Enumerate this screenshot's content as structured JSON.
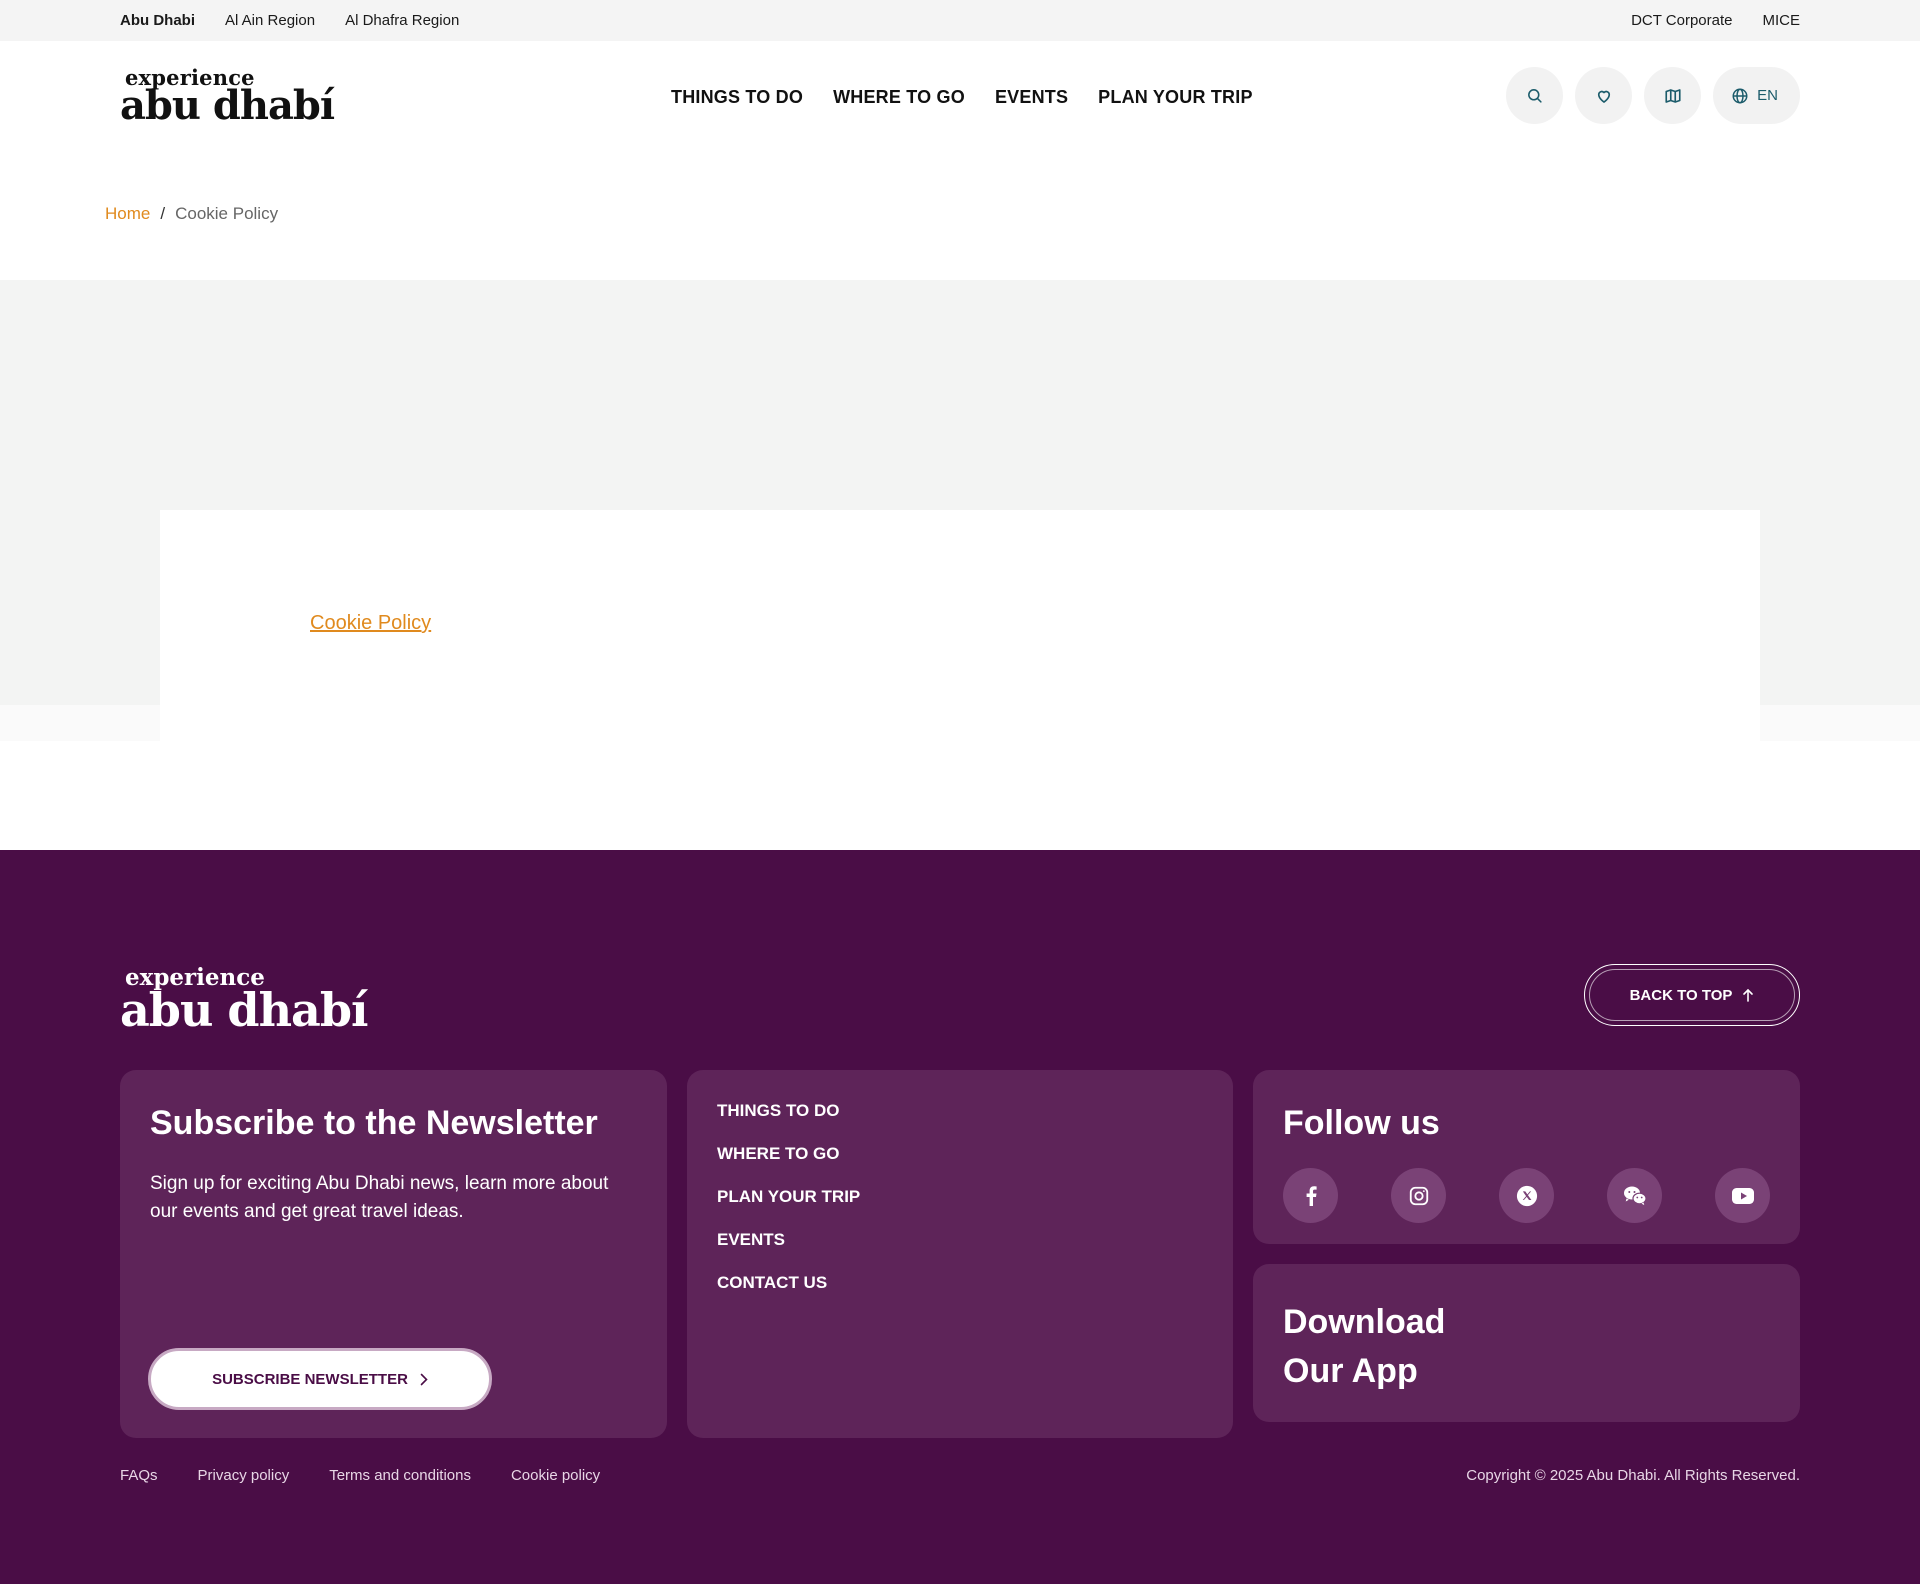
{
  "topbar": {
    "left_links": [
      "Abu Dhabi",
      "Al Ain Region",
      "Al Dhafra Region"
    ],
    "right_links": [
      "DCT Corporate",
      "MICE"
    ]
  },
  "header": {
    "logo_small": "experience",
    "logo_big": "abu dhabí",
    "nav": [
      "THINGS TO DO",
      "WHERE TO GO",
      "EVENTS",
      "PLAN YOUR TRIP"
    ],
    "actions": {
      "search_icon": "search-icon",
      "favorites_icon": "heart-icon",
      "map_icon": "map-icon",
      "language_icon": "globe-icon",
      "language": "EN"
    }
  },
  "breadcrumb": {
    "home": "Home",
    "separator": "/",
    "current": "Cookie Policy"
  },
  "content": {
    "link": "Cookie Policy"
  },
  "footer": {
    "logo_small": "experience",
    "logo_big": "abu dhabí",
    "back_to_top": "BACK TO TOP",
    "newsletter": {
      "title": "Subscribe to the Newsletter",
      "description": "Sign up for exciting Abu Dhabi news, learn more about our events and get great travel ideas.",
      "button": "SUBSCRIBE NEWSLETTER"
    },
    "links": [
      "THINGS TO DO",
      "WHERE TO GO",
      "PLAN YOUR TRIP",
      "EVENTS",
      "CONTACT US"
    ],
    "follow": {
      "title": "Follow us",
      "socials": [
        "facebook-icon",
        "instagram-icon",
        "x-icon",
        "wechat-icon",
        "youtube-icon"
      ]
    },
    "app": {
      "title_line1": "Download",
      "title_line2": "Our App"
    },
    "legal": [
      "FAQs",
      "Privacy policy",
      "Terms and conditions",
      "Cookie policy"
    ],
    "copyright": "Copyright © 2025 Abu Dhabi. All Rights Reserved."
  },
  "colors": {
    "accent": "#e08a1e",
    "footer_bg": "#4a0d46",
    "footer_card": "#5e2459",
    "icon_teal": "#1c5c6b"
  }
}
